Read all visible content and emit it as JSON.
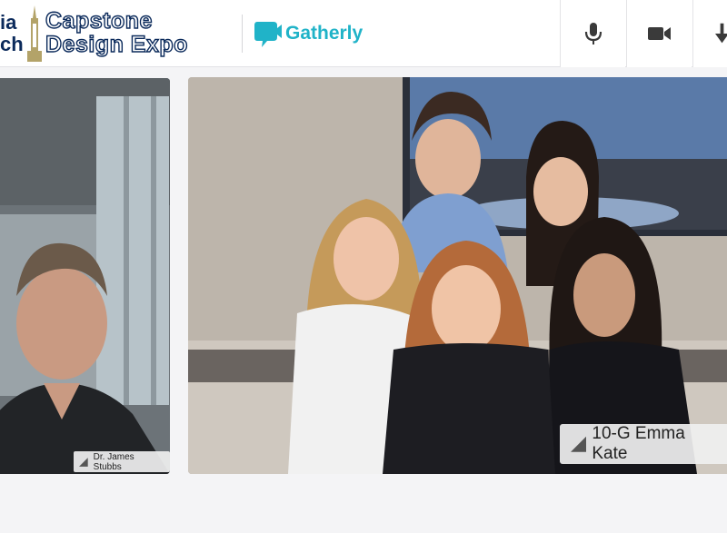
{
  "header": {
    "org_logo_line1": "ia",
    "org_logo_line2": "ch",
    "event_title_line1": "Capstone",
    "event_title_line2": "Design Expo",
    "platform_name": "Gatherly"
  },
  "controls": [
    {
      "name": "microphone",
      "icon": "microphone-icon"
    },
    {
      "name": "camera",
      "icon": "video-camera-icon"
    },
    {
      "name": "download",
      "icon": "down-arrow-icon"
    }
  ],
  "participants": [
    {
      "name": "Dr. James Stubbs",
      "icon": "signal-strength-icon"
    },
    {
      "name": "10-G Emma Kate",
      "icon": "signal-strength-icon"
    }
  ],
  "colors": {
    "brand_navy": "#0b2a5b",
    "brand_gold": "#b3a369",
    "gatherly_teal": "#20b3c8"
  }
}
